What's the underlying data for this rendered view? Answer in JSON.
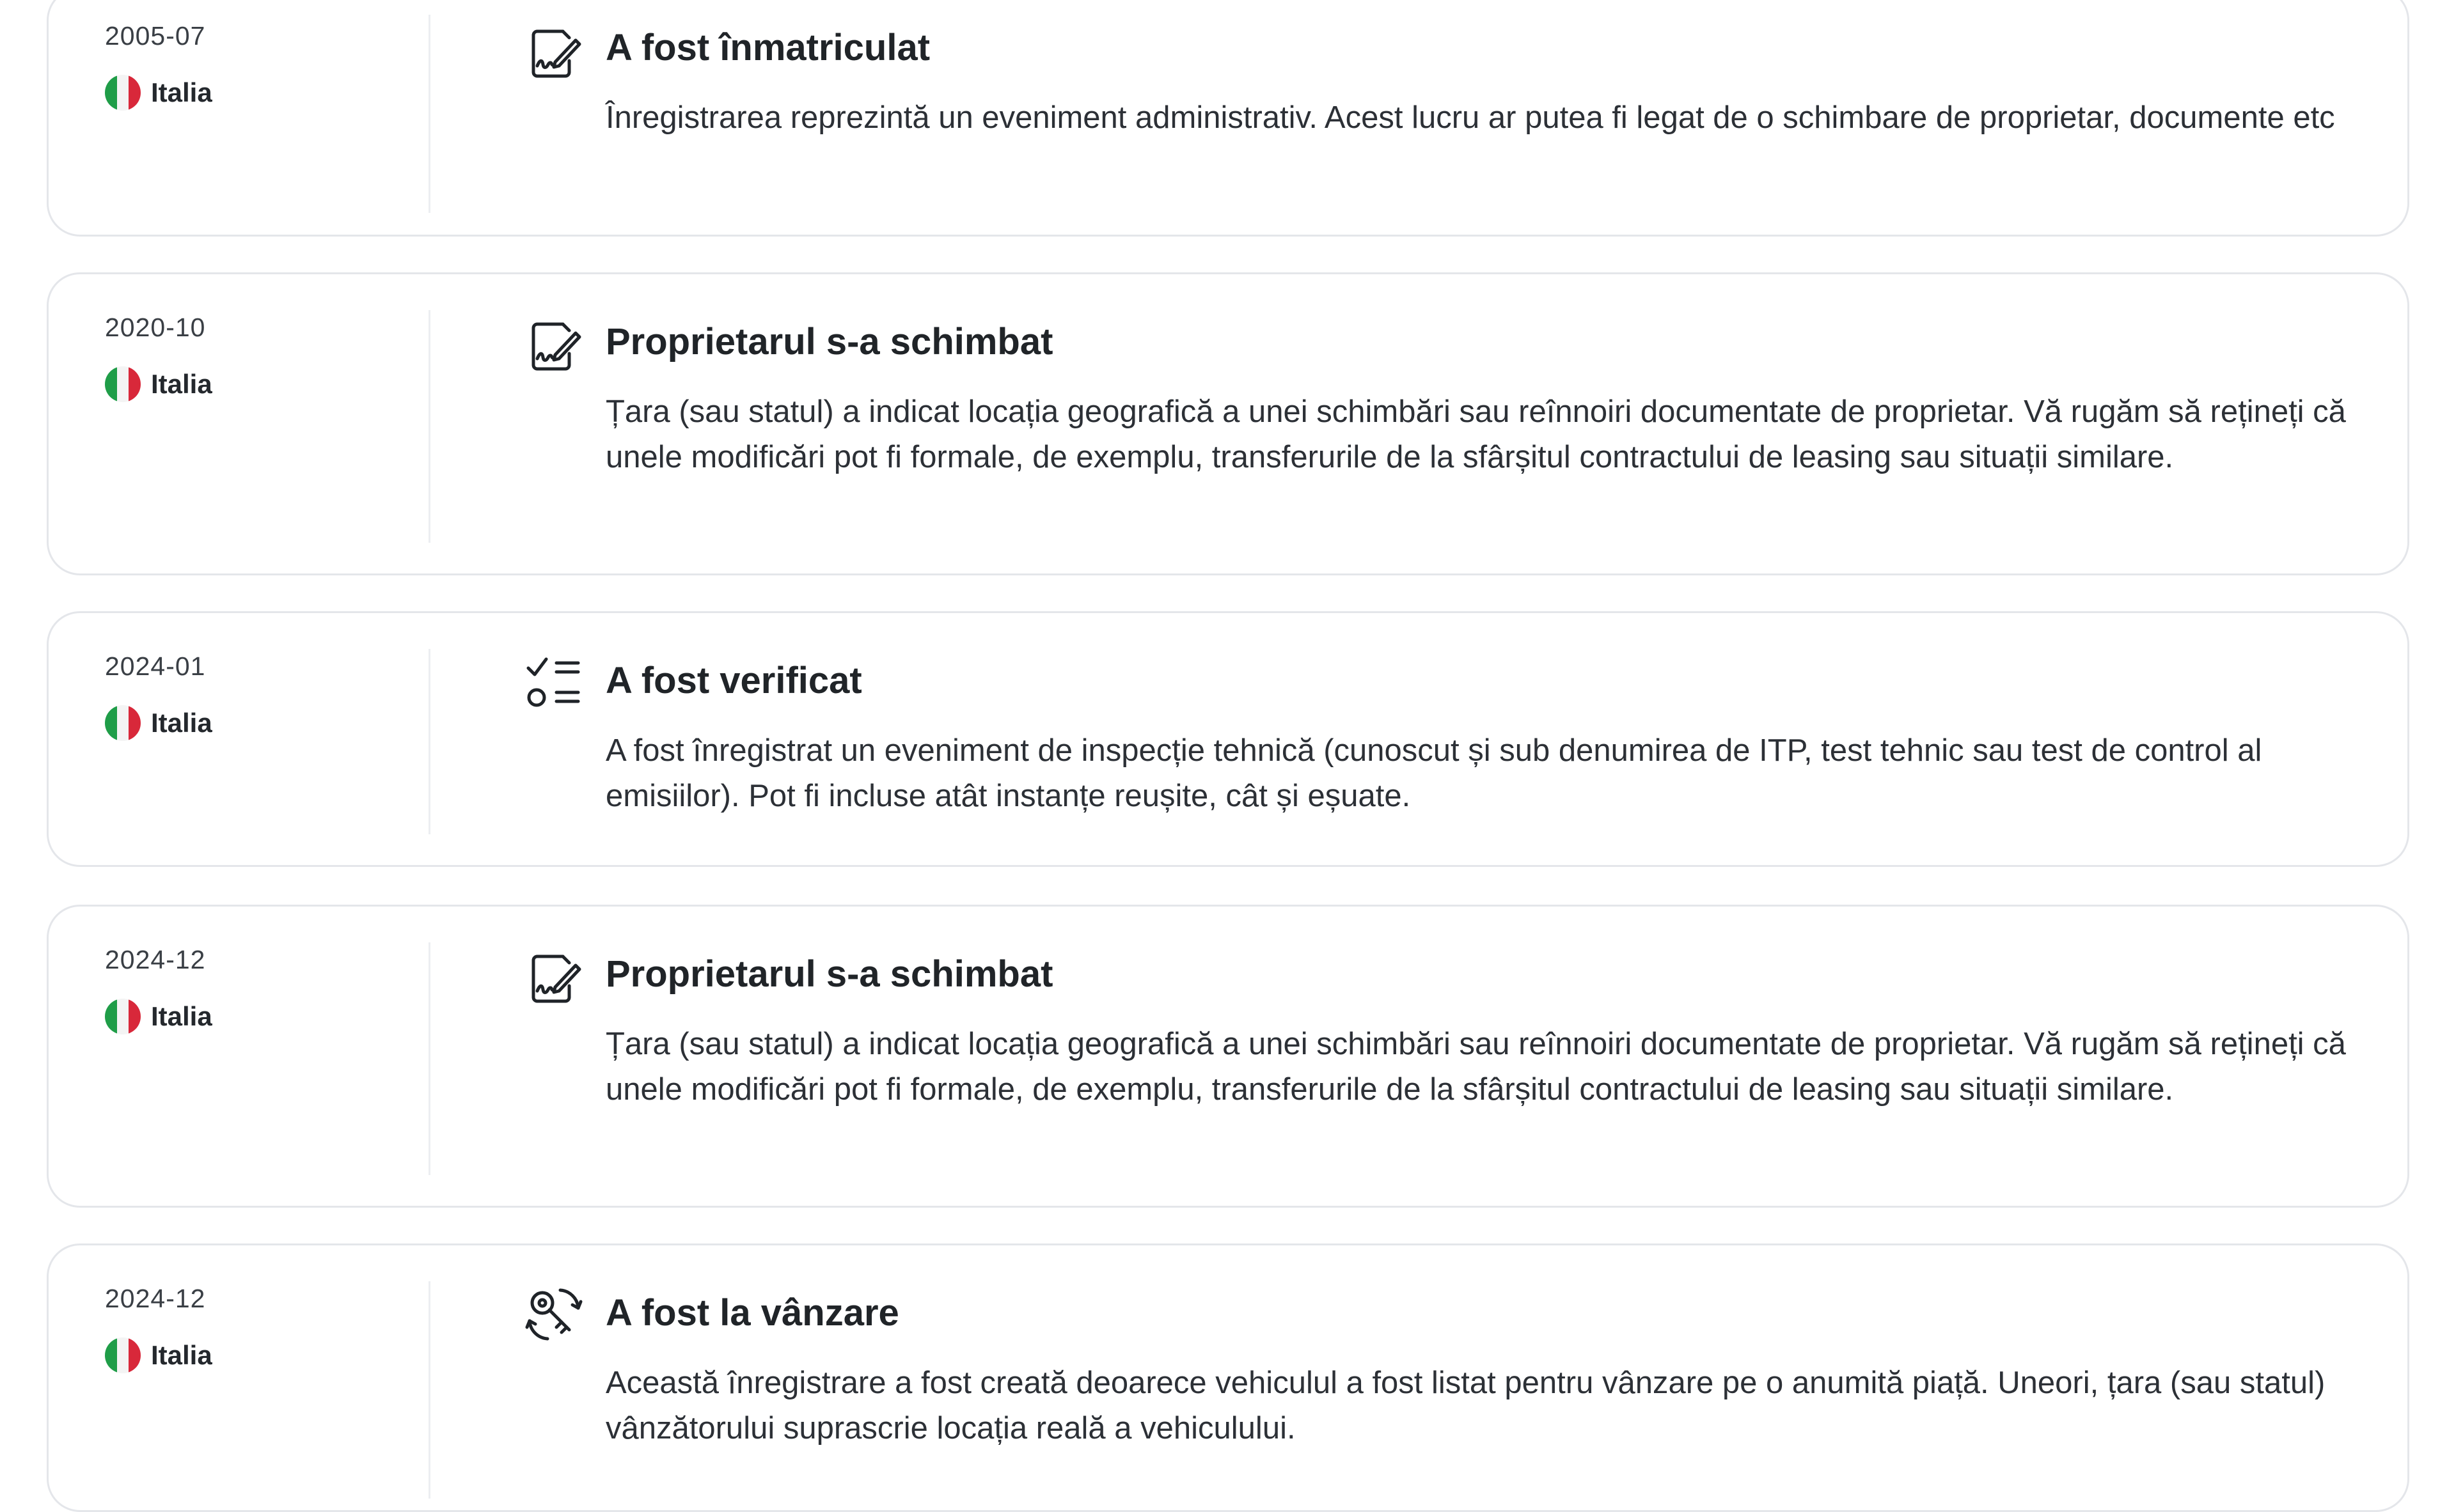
{
  "events": [
    {
      "date": "2005-07",
      "country": "Italia",
      "icon": "document-signature-icon",
      "title": "A fost înmatriculat",
      "description": "Înregistrarea reprezintă un eveniment administrativ. Acest lucru ar putea fi legat de o schimbare de proprietar, documente etc"
    },
    {
      "date": "2020-10",
      "country": "Italia",
      "icon": "document-signature-icon",
      "title": "Proprietarul s-a schimbat",
      "description": "Țara (sau statul) a indicat locația geografică a unei schimbări sau reînnoiri documentate de proprietar. Vă rugăm să rețineți că unele modificări pot fi formale, de exemplu, transferurile de la sfârșitul contractului de leasing sau situații similare."
    },
    {
      "date": "2024-01",
      "country": "Italia",
      "icon": "checklist-icon",
      "title": "A fost verificat",
      "description": "A fost înregistrat un eveniment de inspecție tehnică (cunoscut și sub denumirea de ITP, test tehnic sau test de control al emisiilor). Pot fi incluse atât instanțe reușite, cât și eșuate."
    },
    {
      "date": "2024-12",
      "country": "Italia",
      "icon": "document-signature-icon",
      "title": "Proprietarul s-a schimbat",
      "description": "Țara (sau statul) a indicat locația geografică a unei schimbări sau reînnoiri documentate de proprietar. Vă rugăm să rețineți că unele modificări pot fi formale, de exemplu, transferurile de la sfârșitul contractului de leasing sau situații similare."
    },
    {
      "date": "2024-12",
      "country": "Italia",
      "icon": "key-exchange-icon",
      "title": "A fost la vânzare",
      "description": "Această înregistrare a fost creată deoarece vehiculul a fost listat pentru vânzare pe o anumită piață. Uneori, țara (sau statul) vânzătorului suprascrie locația reală a vehiculului."
    }
  ],
  "colors": {
    "card_border": "#e4e6ea",
    "divider": "#eceef1",
    "flag_green": "#1f9d48",
    "flag_white": "#f4f4f4",
    "flag_red": "#d8283a",
    "text_primary": "#202428"
  }
}
